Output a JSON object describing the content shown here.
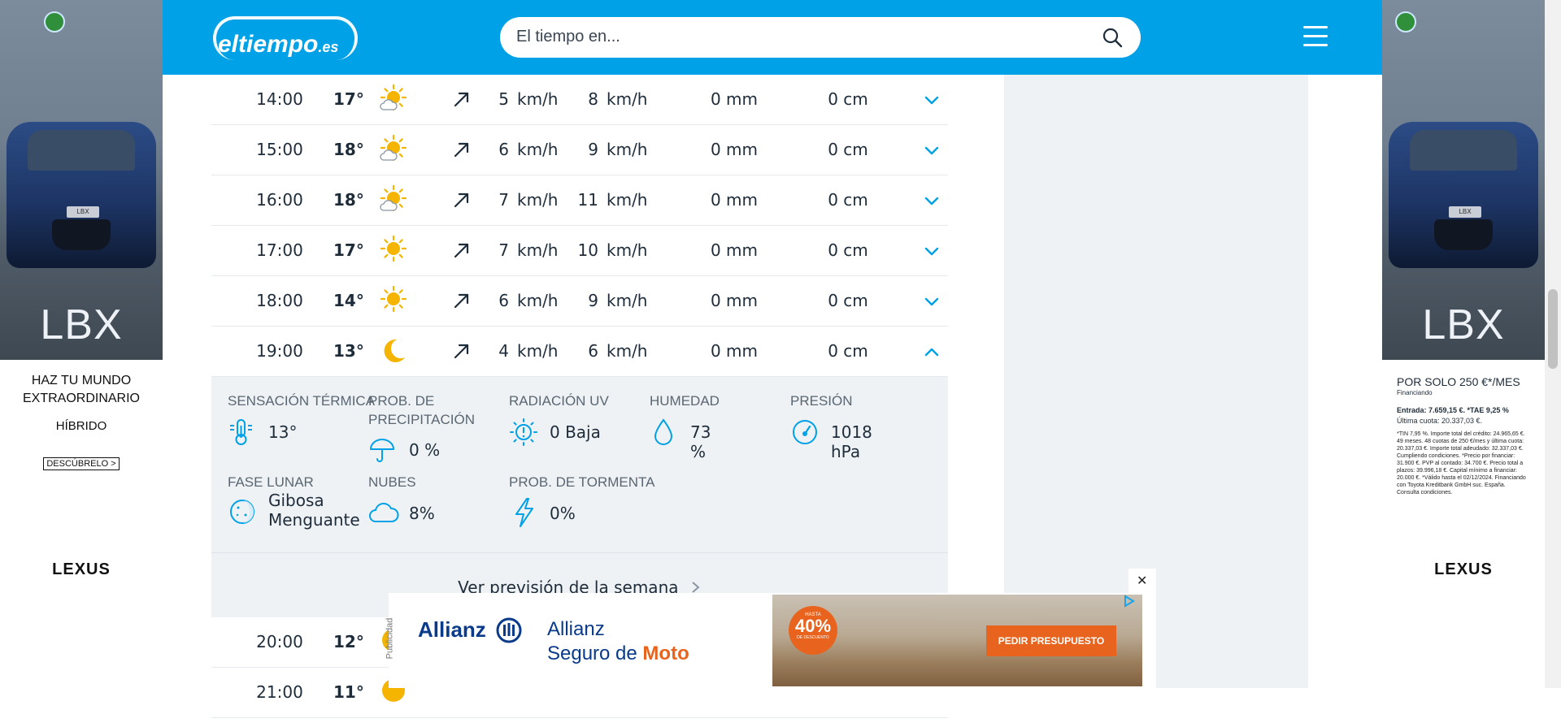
{
  "brand": {
    "logo_main": "eltiempo",
    "logo_tld": ".es",
    "accent_color": "#00a1e6"
  },
  "search": {
    "placeholder": "El tiempo en..."
  },
  "hours": [
    {
      "time": "14:00",
      "temp": "17°",
      "icon": "sun-cloud-icon",
      "wind": "5",
      "wind_unit": "km/h",
      "gust": "8",
      "gust_unit": "km/h",
      "rain": "0 mm",
      "snow": "0 cm",
      "expanded": false
    },
    {
      "time": "15:00",
      "temp": "18°",
      "icon": "sun-cloud-icon",
      "wind": "6",
      "wind_unit": "km/h",
      "gust": "9",
      "gust_unit": "km/h",
      "rain": "0 mm",
      "snow": "0 cm",
      "expanded": false
    },
    {
      "time": "16:00",
      "temp": "18°",
      "icon": "sun-cloud-icon",
      "wind": "7",
      "wind_unit": "km/h",
      "gust": "11",
      "gust_unit": "km/h",
      "rain": "0 mm",
      "snow": "0 cm",
      "expanded": false
    },
    {
      "time": "17:00",
      "temp": "17°",
      "icon": "sun-icon",
      "wind": "7",
      "wind_unit": "km/h",
      "gust": "10",
      "gust_unit": "km/h",
      "rain": "0 mm",
      "snow": "0 cm",
      "expanded": false
    },
    {
      "time": "18:00",
      "temp": "14°",
      "icon": "sun-icon",
      "wind": "6",
      "wind_unit": "km/h",
      "gust": "9",
      "gust_unit": "km/h",
      "rain": "0 mm",
      "snow": "0 cm",
      "expanded": false
    },
    {
      "time": "19:00",
      "temp": "13°",
      "icon": "moon-icon",
      "wind": "4",
      "wind_unit": "km/h",
      "gust": "6",
      "gust_unit": "km/h",
      "rain": "0 mm",
      "snow": "0 cm",
      "expanded": true
    }
  ],
  "details": {
    "sensacion_label": "SENSACIÓN TÉRMICA",
    "sensacion_value": "13°",
    "precip_label_1": "PROB. DE",
    "precip_label_2": "PRECIPITACIÓN",
    "precip_value": "0 %",
    "uv_label": "RADIACIÓN UV",
    "uv_value": "0 Baja",
    "humedad_label": "HUMEDAD",
    "humedad_value": "73 %",
    "presion_label": "PRESIÓN",
    "presion_value": "1018 hPa",
    "fase_label": "FASE LUNAR",
    "fase_value_1": "Gibosa",
    "fase_value_2": "Menguante",
    "nubes_label": "NUBES",
    "nubes_value": "8%",
    "tormenta_label": "PROB. DE TORMENTA",
    "tormenta_value": "0%"
  },
  "week_link": "Ver previsión de la semana",
  "later_hours": [
    {
      "time": "20:00",
      "temp": "12°"
    },
    {
      "time": "21:00",
      "temp": "11°"
    }
  ],
  "side_ads": {
    "model": "LBX",
    "left_line1": "HAZ TU MUNDO",
    "left_line2": "EXTRAORDINARIO",
    "left_line3": "HÍBRIDO",
    "left_cta": "DESCÚBRELO >",
    "brand": "LEXUS",
    "plate": "LBX",
    "right_price": "POR SOLO 250 €*/MES",
    "right_sub": "Financiando",
    "right_l1": "Entrada: 7.659,15 €. *TAE 9,25 %",
    "right_l2": "Última cuota: 20.337,03 €.",
    "right_fine": "*TIN 7,95 %. Importe total del crédito: 24.965,65 €. 49 meses. 48 cuotas de 250 €/mes y última cuota: 20.337,03 €. Importe total adeudado: 32.337,03 €. Cumpliendo condiciones. *Precio por financiar: 31.900 €. PVP al contado: 34.700 €. Precio total a plazos: 39.996,18 €. Capital mínimo a financiar: 20.000 €. *Válido hasta el 02/12/2024. Financiando con Toyota Kreditbank GmbH suc. España. Consulta condiciones."
  },
  "bottom_ad": {
    "label": "Publicidad",
    "logo": "Allianz",
    "line1": "Allianz",
    "line2_a": "Seguro de ",
    "line2_b": "Moto",
    "badge_top": "HASTA",
    "badge_value": "40%",
    "badge_bottom": "DE DESCUENTO",
    "cta": "PEDIR PRESUPUESTO",
    "close": "✕"
  }
}
